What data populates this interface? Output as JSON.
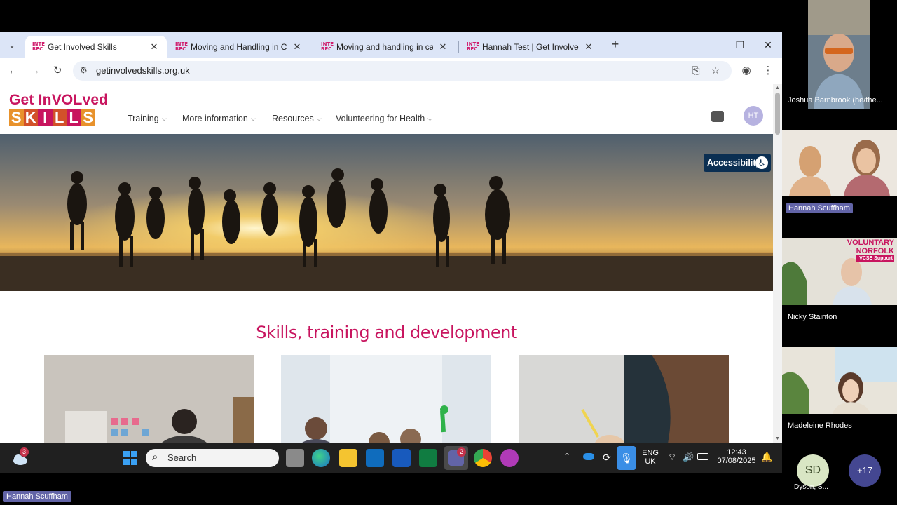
{
  "browser": {
    "tabs": [
      {
        "title": "Get Involved Skills",
        "active": true
      },
      {
        "title": "Moving and Handling in Care |",
        "active": false
      },
      {
        "title": "Moving and handling in care: A",
        "active": false
      },
      {
        "title": "Hannah Test | Get Involved Skil",
        "active": false
      }
    ],
    "favicon_text": "INTE\nRFC",
    "url": "getinvolvedskills.org.uk"
  },
  "site": {
    "logo_line1": "Get InVOLved",
    "logo_line2": [
      "S",
      "K",
      "I",
      "L",
      "L",
      "S"
    ],
    "logo_colors": [
      "#e8922c",
      "#d2512a",
      "#c8155f",
      "#d2512a",
      "#c8155f",
      "#e8922c"
    ],
    "nav": [
      {
        "label": "Training"
      },
      {
        "label": "More information"
      },
      {
        "label": "Resources"
      },
      {
        "label": "Volunteering for Health"
      }
    ],
    "user_initials": "HT",
    "accessibility_label": "Accessibility",
    "section_title": "Skills, training and development"
  },
  "taskbar": {
    "search_placeholder": "Search",
    "weather_badge": "3",
    "teams_badge": "2",
    "lang_line1": "ENG",
    "lang_line2": "UK",
    "time": "12:43",
    "date": "07/08/2025"
  },
  "meeting": {
    "participants": [
      {
        "name": "Joshua Barnbrook (he/the..."
      },
      {
        "name": "Hannah Scuffham"
      },
      {
        "name": "Nicky Stainton"
      },
      {
        "name": "Madeleine Rhodes"
      }
    ],
    "overflow_initials": "SD",
    "overflow_name": "Dyson, S...",
    "more_count": "+17",
    "presenter_name": "Hannah Scuffham",
    "banner_line1": "VOLUNTARY",
    "banner_line2": "NORFOLK",
    "banner_line3": "VCSE Support"
  },
  "colors": {
    "brand_pink": "#c8155f",
    "chrome_tabstrip": "#dce5f7",
    "accessibility_bg": "#0b2f52",
    "teams_purple": "#6264a7"
  }
}
